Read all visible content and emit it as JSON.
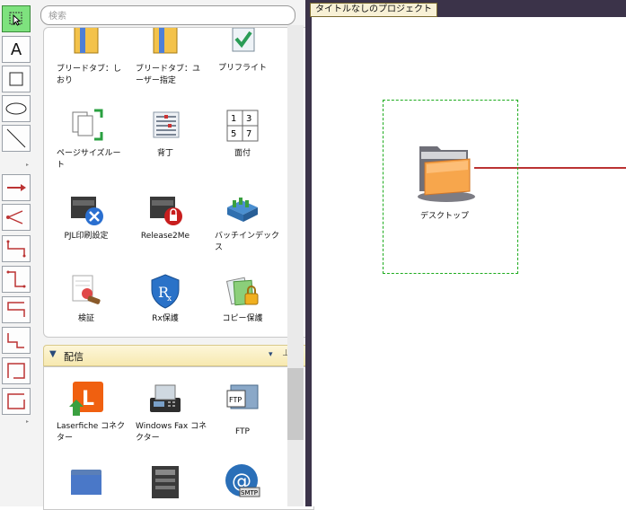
{
  "search": {
    "placeholder": "検索"
  },
  "tools": [
    {
      "name": "select-tool"
    },
    {
      "name": "text-tool",
      "label": "A"
    },
    {
      "name": "rectangle-tool"
    },
    {
      "name": "ellipse-tool"
    },
    {
      "name": "line-tool"
    },
    {
      "name": "arrow-connector-tool"
    },
    {
      "name": "branch-connector-tool"
    },
    {
      "name": "elbow-connector-tool-1"
    },
    {
      "name": "elbow-connector-tool-2"
    },
    {
      "name": "elbow-connector-tool-3"
    },
    {
      "name": "elbow-connector-tool-4"
    },
    {
      "name": "elbow-connector-tool-5"
    },
    {
      "name": "elbow-connector-tool-6"
    }
  ],
  "palette": {
    "group1": {
      "items": [
        {
          "label": "ブリードタブ：しおり",
          "icon": "bleed-tab-bookmark-icon"
        },
        {
          "label": "ブリードタブ：ユーザー指定",
          "icon": "bleed-tab-user-icon"
        },
        {
          "label": "プリフライト",
          "icon": "preflight-icon"
        },
        {
          "label": "ページサイズルート",
          "icon": "page-size-route-icon"
        },
        {
          "label": "背丁",
          "icon": "spine-mark-icon"
        },
        {
          "label": "面付",
          "icon": "imposition-icon"
        },
        {
          "label": "PJL印刷設定",
          "icon": "pjl-print-settings-icon"
        },
        {
          "label": "Release2Me",
          "icon": "release2me-icon"
        },
        {
          "label": "バッチインデックス",
          "icon": "batch-index-icon"
        },
        {
          "label": "検証",
          "icon": "verify-icon"
        },
        {
          "label": "Rx保護",
          "icon": "rx-protect-icon"
        },
        {
          "label": "コピー保護",
          "icon": "copy-protect-icon"
        }
      ]
    },
    "group2": {
      "title": "配信",
      "items": [
        {
          "label": "Laserfiche コネクター",
          "icon": "laserfiche-connector-icon"
        },
        {
          "label": "Windows Fax コネクター",
          "icon": "windows-fax-connector-icon"
        },
        {
          "label": "FTP",
          "icon": "ftp-icon"
        },
        {
          "label": "",
          "icon": "folder-icon"
        },
        {
          "label": "",
          "icon": "printer-icon"
        },
        {
          "label": "",
          "icon": "smtp-icon"
        }
      ]
    }
  },
  "canvas": {
    "project_title": "タイトルなしのプロジェクト",
    "node": {
      "label": "デスクトップ",
      "icon": "desktop-folder-icon"
    }
  },
  "colors": {
    "selected_tool": "#7ee27e",
    "selection_border": "#1dab1d",
    "connector": "#b33333",
    "group_header": "#f7e9b0"
  }
}
